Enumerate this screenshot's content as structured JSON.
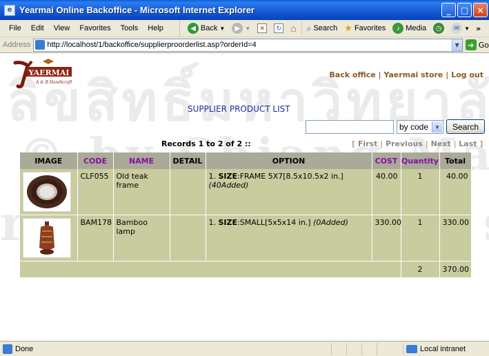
{
  "window": {
    "title": "Yearmai Online Backoffice - Microsoft Internet Explorer"
  },
  "menu": [
    "File",
    "Edit",
    "View",
    "Favorites",
    "Tools",
    "Help"
  ],
  "toolbar": {
    "back": "Back",
    "search": "Search",
    "favorites": "Favorites",
    "media": "Media",
    "more": "»"
  },
  "address": {
    "label": "Address",
    "url": "http://localhost/1/backoffice/supplierproorderlist.asp?orderId=4",
    "go": "Go"
  },
  "header": {
    "logo_text": "YAERMAI",
    "nav": [
      "Back office",
      "Yaermai store",
      "Log out"
    ],
    "nav_separator": " | "
  },
  "page": {
    "title": "SUPPLIER PRODUCT LIST",
    "search": {
      "value": "",
      "select_value": "by code",
      "button": "Search"
    },
    "records": "Records 1 to 2 of 2 ::",
    "pager": [
      "First",
      "Previous",
      "Next",
      "Last"
    ]
  },
  "table": {
    "headers": [
      "IMAGE",
      "CODE",
      "NAME",
      "DETAIL",
      "OPTION",
      "COST",
      "Quantity",
      "Total"
    ],
    "rows": [
      {
        "code": "CLF055",
        "name": "Old teak frame",
        "detail": "",
        "option_index": "1.",
        "option_attr": "SIZE",
        "option_value": ":FRAME 5X7[8.5x10.5x2 in.]",
        "option_stock": "(40Added)",
        "cost": "40.00",
        "qty": "1",
        "total": "40.00"
      },
      {
        "code": "BAM178",
        "name": "Bamboo lamp",
        "detail": "",
        "option_index": "1.",
        "option_attr": "SIZE",
        "option_value": ":SMALL[5x5x14 in.]",
        "option_stock": "(0Added)",
        "cost": "330.00",
        "qty": "1",
        "total": "330.00"
      }
    ],
    "totals": {
      "qty": "2",
      "total": "370.00"
    }
  },
  "statusbar": {
    "status": "Done",
    "zone": "Local intranet"
  },
  "colors": {
    "table_header": "#aaaa99",
    "table_row": "#c9cc9f",
    "title_blue": "#1e2d9b",
    "header_purple": "#8a0ea0",
    "nav_brown": "#8a5a28"
  }
}
